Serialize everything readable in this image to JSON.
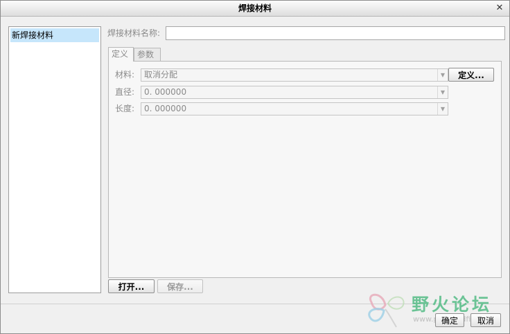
{
  "window": {
    "title": "焊接材料",
    "close_glyph": "✕"
  },
  "left_list": {
    "items": [
      {
        "label": "新焊接材料",
        "selected": true
      }
    ]
  },
  "name_field": {
    "label": "焊接材料名称:",
    "value": ""
  },
  "tabs": [
    {
      "label": "定义",
      "active": true
    },
    {
      "label": "参数",
      "active": false
    }
  ],
  "definition": {
    "material": {
      "label": "材料:",
      "value": "取消分配",
      "button": "定义..."
    },
    "diameter": {
      "label": "直径:",
      "value": "0. 000000"
    },
    "length": {
      "label": "长度:",
      "value": "0. 000000"
    }
  },
  "bottom_buttons": {
    "open": "打开...",
    "save": "保存..."
  },
  "dialog_buttons": {
    "ok": "确定",
    "cancel": "取消"
  },
  "watermark": {
    "text": "野火论坛",
    "url": "www.proewildfire.cn"
  },
  "colors": {
    "selection": "#c6e6fb",
    "watermark": "#5dbf8c"
  }
}
